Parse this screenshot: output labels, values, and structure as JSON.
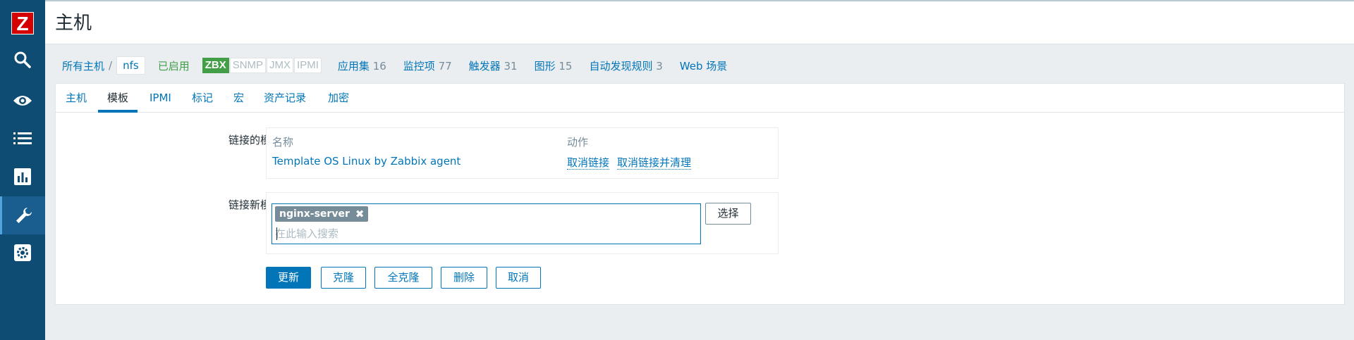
{
  "sidebar": {
    "logo": "Z",
    "items": [
      {
        "name": "search",
        "icon": "search-icon"
      },
      {
        "name": "monitoring",
        "icon": "eye-icon"
      },
      {
        "name": "inventory",
        "icon": "list-icon"
      },
      {
        "name": "reports",
        "icon": "chart-icon"
      },
      {
        "name": "configuration",
        "icon": "wrench-icon",
        "active": true
      },
      {
        "name": "administration",
        "icon": "gear-icon"
      }
    ]
  },
  "header": {
    "title": "主机"
  },
  "hostnav": {
    "all_hosts": "所有主机",
    "separator": "/",
    "host": "nfs",
    "status": "已启用",
    "availability": [
      "ZBX",
      "SNMP",
      "JMX",
      "IPMI"
    ],
    "links": [
      {
        "label": "应用集",
        "count": "16"
      },
      {
        "label": "监控项",
        "count": "77"
      },
      {
        "label": "触发器",
        "count": "31"
      },
      {
        "label": "图形",
        "count": "15"
      },
      {
        "label": "自动发现规则",
        "count": "3"
      },
      {
        "label": "Web 场景",
        "count": ""
      }
    ]
  },
  "tabs": [
    "主机",
    "模板",
    "IPMI",
    "标记",
    "宏",
    "资产记录",
    "加密"
  ],
  "active_tab": "模板",
  "linked_templates": {
    "label": "链接的模板",
    "col_name": "名称",
    "col_action": "动作",
    "rows": [
      {
        "name": "Template OS Linux by Zabbix agent",
        "unlink": "取消链接",
        "unlink_clear": "取消链接并清理"
      }
    ]
  },
  "new_templates": {
    "label": "链接新模板",
    "selected": [
      "nginx-server"
    ],
    "remove_symbol": "✖",
    "placeholder": "在此输入搜索",
    "select_button": "选择"
  },
  "buttons": {
    "update": "更新",
    "clone": "克隆",
    "full_clone": "全克隆",
    "delete": "删除",
    "cancel": "取消"
  },
  "colors": {
    "sidebar": "#0f4c74",
    "accent": "#0275b8",
    "enabled": "#429e47",
    "logo": "#d40000"
  }
}
